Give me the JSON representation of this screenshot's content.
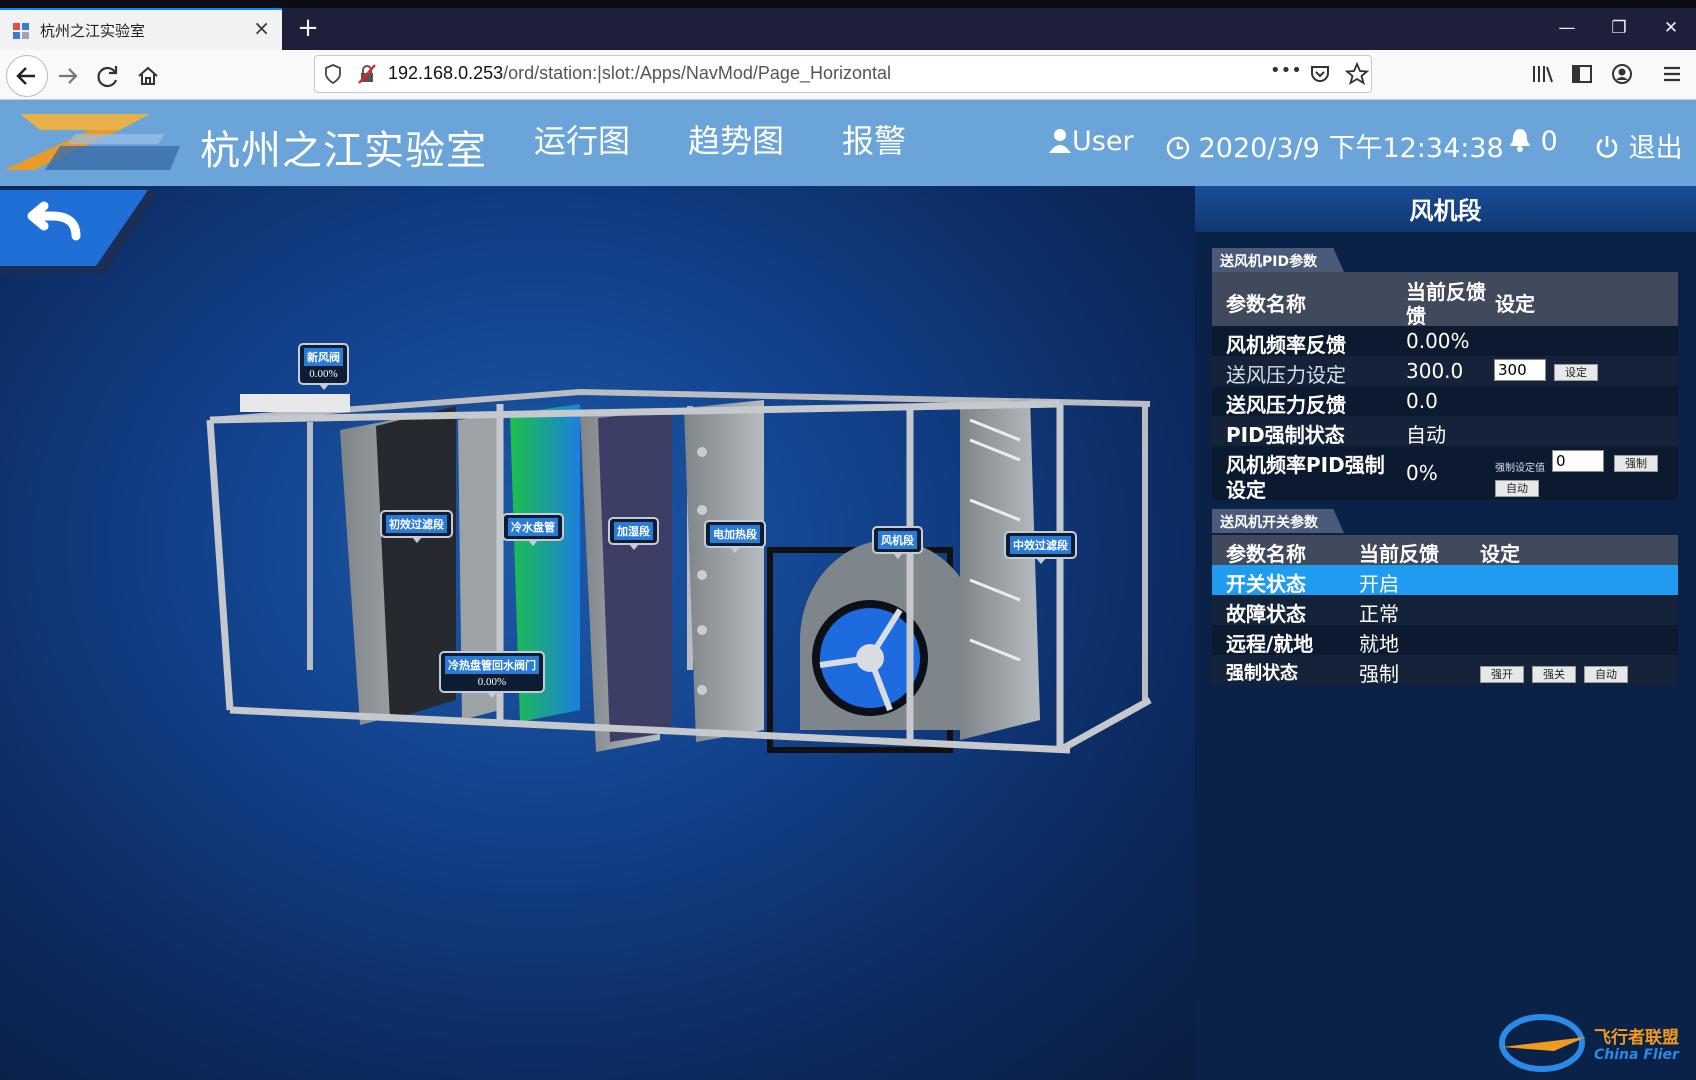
{
  "browser": {
    "tab_title": "杭州之江实验室",
    "new_tab": "+",
    "url_host": "192.168.0.253",
    "url_path": "/ord/station:|slot:/Apps/NavMod/Page_Horizontal",
    "url_more": "•••"
  },
  "app": {
    "title": "杭州之江实验室",
    "menu": [
      "运行图",
      "趋势图",
      "报警"
    ],
    "user": "User",
    "datetime": "2020/3/9 下午12:34:38",
    "alarm_count": "0",
    "logout": "退出"
  },
  "scene_labels": [
    {
      "label": "新风阀",
      "value": "0.00%"
    },
    {
      "label": "初效过滤段"
    },
    {
      "label": "冷水盘管"
    },
    {
      "label": "冷热盘管回水阀门",
      "value": "0.00%"
    },
    {
      "label": "加湿段"
    },
    {
      "label": "电加热段"
    },
    {
      "label": "风机段"
    },
    {
      "label": "中效过滤段"
    }
  ],
  "panel": {
    "title": "风机段",
    "pid_section": {
      "tab": "送风机PID参数",
      "headers": [
        "参数名称",
        "当前反馈",
        "设定"
      ],
      "header_feedback_line2": "馈",
      "rows": [
        {
          "name": "风机频率反馈",
          "value": "0.00%"
        },
        {
          "name": "送风压力设定",
          "value": "300.0",
          "input": "300",
          "button": "设定"
        },
        {
          "name": "送风压力反馈",
          "value": "0.0"
        },
        {
          "name": "PID强制状态",
          "value": "自动"
        },
        {
          "name": "风机频率PID强制",
          "name_line2": "设定",
          "value": "0%",
          "force_label": "强制设定值",
          "input": "0",
          "button_force": "强制",
          "button_auto": "自动"
        }
      ]
    },
    "switch_section": {
      "tab": "送风机开关参数",
      "headers": [
        "参数名称",
        "当前反馈",
        "设定"
      ],
      "rows": [
        {
          "name": "开关状态",
          "value": "开启"
        },
        {
          "name": "故障状态",
          "value": "正常"
        },
        {
          "name": "远程/就地",
          "value": "就地"
        },
        {
          "name": "强制状态",
          "value": "强制",
          "buttons": [
            "强开",
            "强关",
            "自动"
          ]
        }
      ]
    }
  },
  "watermark": {
    "cn": "飞行者联盟",
    "en": "China Flier"
  },
  "colors": {
    "header": "#6aa4d8",
    "selected_row": "#1f9bf0",
    "panel_bg": "#0b2248"
  }
}
